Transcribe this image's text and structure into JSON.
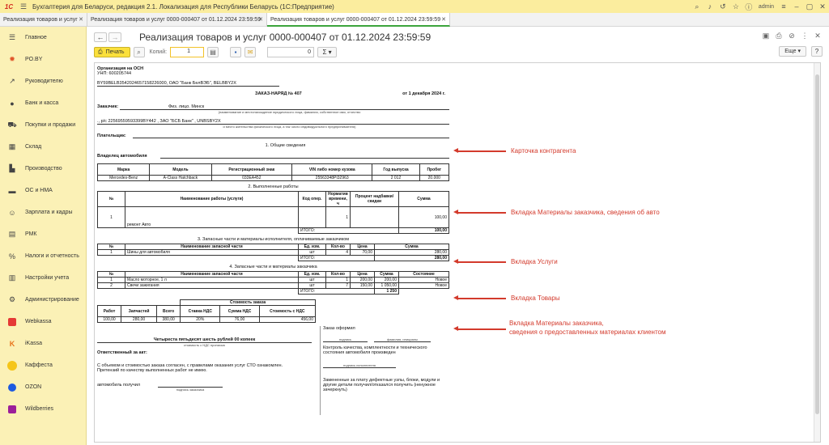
{
  "titlebar": {
    "logo": "1С",
    "title": "Бухгалтерия для Беларуси, редакция 2.1. Локализация для Республики Беларусь   (1С:Предприятие)",
    "user": "admin"
  },
  "tabs": [
    {
      "label": "Реализация товаров и услуг"
    },
    {
      "label": "Реализация товаров и услуг 0000-000407 от 01.12.2024 23:59:59"
    },
    {
      "label": "Реализация товаров и услуг 0000-000407 от 01.12.2024 23:59:59"
    }
  ],
  "sidebar": {
    "items": [
      {
        "label": "Главное",
        "icon": "menu-icon"
      },
      {
        "label": "PO.BY",
        "icon": "sun-icon"
      },
      {
        "label": "Руководителю",
        "icon": "chart-icon"
      },
      {
        "label": "Банк и касса",
        "icon": "coin-icon"
      },
      {
        "label": "Покупки и продажи",
        "icon": "cart-icon"
      },
      {
        "label": "Склад",
        "icon": "warehouse-icon"
      },
      {
        "label": "Производство",
        "icon": "factory-icon"
      },
      {
        "label": "ОС и НМА",
        "icon": "truck-icon"
      },
      {
        "label": "Зарплата и кадры",
        "icon": "people-icon"
      },
      {
        "label": "РМК",
        "icon": "register-icon"
      },
      {
        "label": "Налоги и отчетность",
        "icon": "tax-icon"
      },
      {
        "label": "Настройки учета",
        "icon": "settings-icon"
      },
      {
        "label": "Администрирование",
        "icon": "gear-icon"
      },
      {
        "label": "Webkassa",
        "icon": "webkassa-icon"
      },
      {
        "label": "iKassa",
        "icon": "ikassa-icon"
      },
      {
        "label": "Каффеста",
        "icon": "kaffesta-icon"
      },
      {
        "label": "OZON",
        "icon": "ozon-icon"
      },
      {
        "label": "Wildberries",
        "icon": "wildberries-icon"
      }
    ]
  },
  "document": {
    "title": "Реализация товаров и услуг 0000-000407 от 01.12.2024 23:59:59",
    "print_label": "Печать",
    "copies_label": "Копий:",
    "copies_value": "1",
    "sum_value": "0",
    "sum_button": "Σ",
    "more_label": "Еще",
    "help_label": "?"
  },
  "form": {
    "org": "Организация на ОСН",
    "unp": "УНП: 600205744",
    "bank": "BY59BELB3542024657158226000, ОАО \"Банк БелВЭБ\", BELBBY2X",
    "order_title": "ЗАКАЗ-НАРЯД № 407",
    "order_date": "от 1 декабря 2024 г.",
    "customer_label": "Заказчик:",
    "customer_value": "Физ. лицо. Минск",
    "customer_hint": "(наименование и местонахождение юридического лица, фамилия, собственное имя, отчество",
    "customer_account": "., р/с 22569559593399BY442 , ЗАО \"БСБ Банк\" , UNBSBY2X",
    "customer_hint2": "и место жительства физического лица, а так число индивидуального предпринимателя)",
    "payer_label": "Плательщик:",
    "section1": "1. Общие сведения",
    "owner_label": "Владелец автомобиля",
    "car_headers": [
      "Марка",
      "Модель",
      "Регистрационный знак",
      "VIN либо номер кузова",
      "Год выпуска",
      "Пробег"
    ],
    "car_row": [
      "Mercedes-Benz",
      "A-Class Hatchback",
      "033ЕА452",
      "25563348PI32963",
      "2 012",
      "20.000"
    ],
    "section2": "2. Выполненные работы",
    "works_headers": [
      "№",
      "Наименование работы (услуги)",
      "Код опер.",
      "Норматив времени, ч",
      "Процент надбавки/скидки",
      "Сумма"
    ],
    "works_row": [
      "1",
      "ремонт Авто",
      "",
      "1",
      "",
      "100,00"
    ],
    "works_total_label": "ИТОГО:",
    "works_total": "100,00",
    "section3": "3. Запасные части и материалы исполнителя, оплачиваемые заказчиком",
    "parts_headers": [
      "№",
      "Наименование запасной части",
      "Ед. изм.",
      "Кол-во",
      "Цена",
      "Сумма"
    ],
    "parts_row": [
      "1",
      "Шины для автомобиля",
      "шт",
      "4",
      "70,00",
      "280,00"
    ],
    "parts_total_label": "ИТОГО:",
    "parts_total": "280,00",
    "section4": "4. Запасные части и материалы заказчика",
    "cust_headers": [
      "№",
      "Наименование запасной части",
      "Ед. изм.",
      "Кол-во",
      "Цена",
      "Сумма",
      "Состояние"
    ],
    "cust_rows": [
      [
        "1",
        "Масло моторное, 1 л",
        "шт",
        "1",
        "200,00",
        "200,00",
        "Новое"
      ],
      [
        "2",
        "Свечи зажигания",
        "шт",
        "7",
        "150,00",
        "1 050,00",
        "Новое"
      ]
    ],
    "cust_total_label": "ИТОГО:",
    "cust_total": "1 250",
    "cost_title": "Стоимость заказа",
    "cost_headers": [
      "Работ",
      "Запчастей",
      "Всего",
      "Ставка НДС",
      "Сумма НДС",
      "Стоимость с НДС"
    ],
    "cost_row": [
      "100,00",
      "280,00",
      "380,00",
      "20%",
      "76,00",
      "456,00"
    ],
    "amount_words": "Четыреста пятьдесят шесть рублей 00 копеек",
    "amount_hint": "стоимость с НДС прописью",
    "responsible_label": "Ответственный за акт:",
    "agreement": "С объемом и стоимостью заказа согласен, с правилами оказания услуг СТО ознакомлен. Претензий по качеству выполненных работ не имею.",
    "car_received": "автомобиль получил",
    "sign_hint": "подпись заказчика",
    "order_made": "Заказ оформил",
    "sign_hint2": "подпись",
    "name_hint": "фамилия, инициалы",
    "quality": "Контроль качества, комплектности и технического состояния автомобиля произведен",
    "sign_hint3": "подпись исполнителя",
    "replaced": "Замененные за плату дефектные узлы, блоки, модули и другие детали получил/отказался получить (ненужное зачеркнуть)"
  },
  "annotations": {
    "a1": "Карточка контрагента",
    "a2": "Вкладка Материалы заказчика, сведения об авто",
    "a3": "Вкладка Услуги",
    "a4": "Вкладка Товары",
    "a5_line1": "Вкладка Материалы заказчика,",
    "a5_line2": "сведения о предоставленных материалах клиентом"
  },
  "colors": {
    "accent": "#fbe03b",
    "annotation": "#d33a2c",
    "sidebar": "#fbf1b6",
    "titlebar": "#fbed9e",
    "tab_active_line": "#3ca43c"
  }
}
